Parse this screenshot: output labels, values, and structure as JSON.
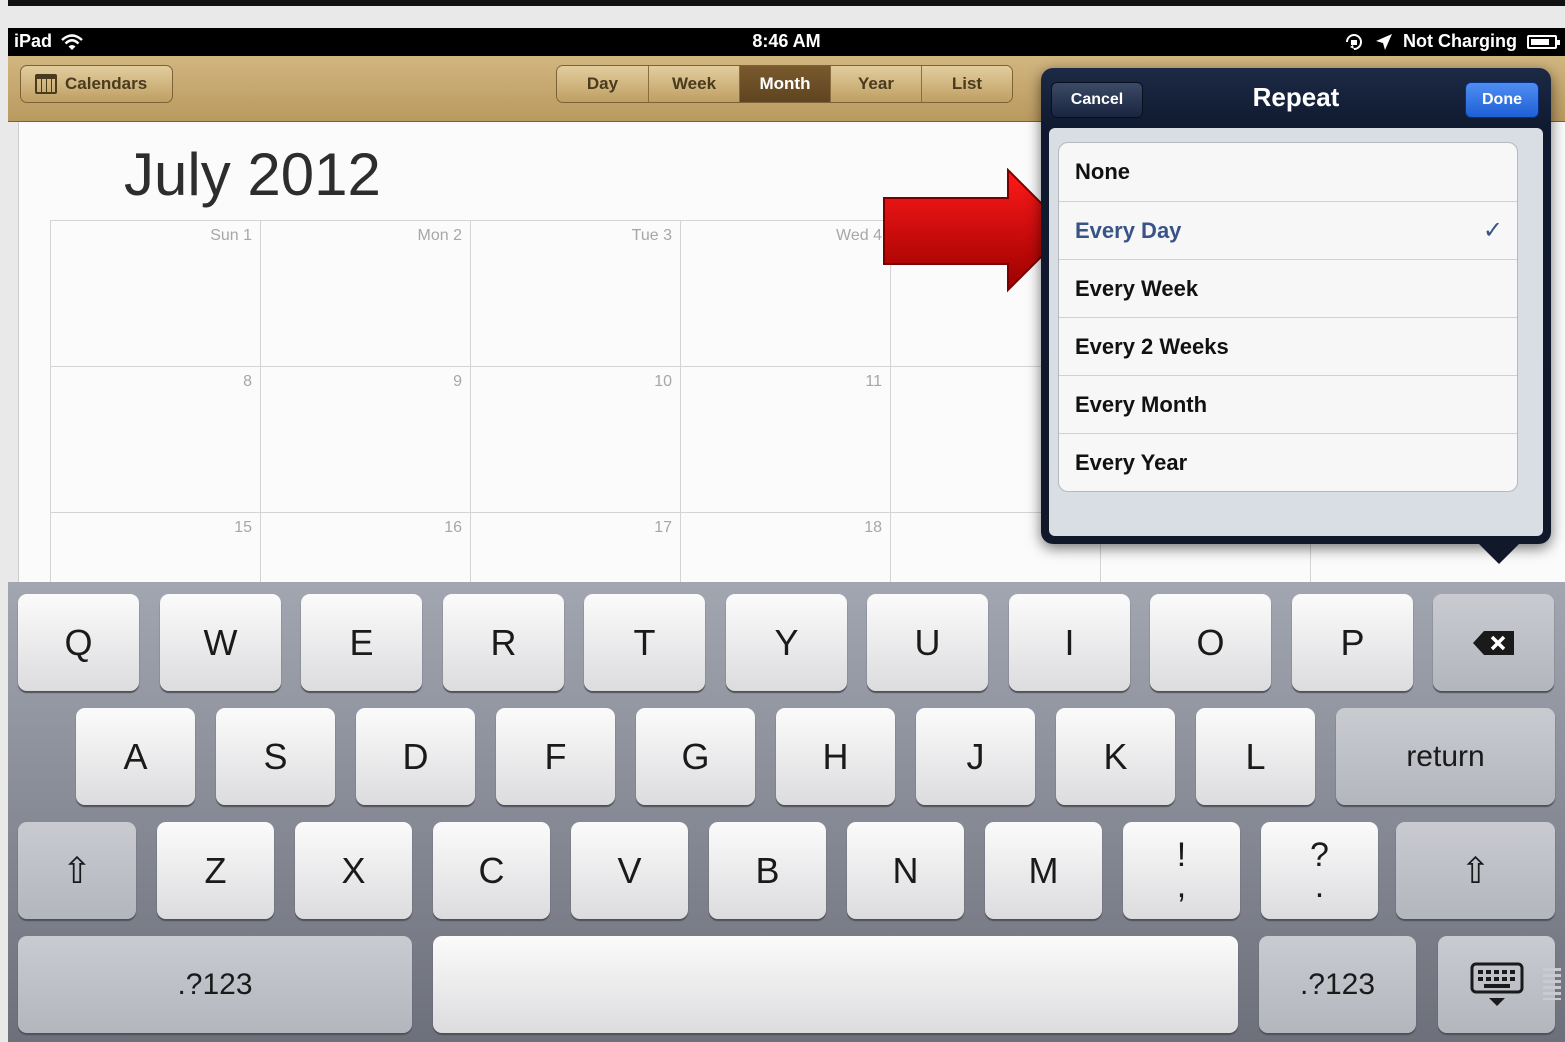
{
  "status_bar": {
    "device": "iPad",
    "time": "8:46 AM",
    "charging": "Not Charging"
  },
  "toolbar": {
    "calendars_label": "Calendars",
    "view_tabs": [
      "Day",
      "Week",
      "Month",
      "Year",
      "List"
    ],
    "active_view": "Month"
  },
  "calendar": {
    "month_title": "July 2012",
    "rows": [
      [
        "Sun 1",
        "Mon 2",
        "Tue 3",
        "Wed 4"
      ],
      [
        "8",
        "9",
        "10",
        "11"
      ],
      [
        "15",
        "16",
        "17",
        "18"
      ]
    ]
  },
  "popover": {
    "title": "Repeat",
    "cancel_label": "Cancel",
    "done_label": "Done",
    "options": [
      "None",
      "Every Day",
      "Every Week",
      "Every 2 Weeks",
      "Every Month",
      "Every Year"
    ],
    "selected": "Every Day",
    "check_glyph": "✓"
  },
  "keyboard": {
    "row1": [
      "Q",
      "W",
      "E",
      "R",
      "T",
      "Y",
      "U",
      "I",
      "O",
      "P"
    ],
    "row2": [
      "A",
      "S",
      "D",
      "F",
      "G",
      "H",
      "J",
      "K",
      "L"
    ],
    "row3": [
      "Z",
      "X",
      "C",
      "V",
      "B",
      "N",
      "M"
    ],
    "punct_1": [
      "!",
      ","
    ],
    "punct_2": [
      "?",
      "."
    ],
    "return_label": "return",
    "numbers_label": ".?123",
    "shift_glyph": "⇧",
    "icons": [
      "wifi-icon",
      "lock-rotation-icon",
      "location-icon",
      "battery-icon",
      "calendar-icon",
      "backspace-icon",
      "shift-icon",
      "keyboard-hide-icon",
      "checkmark-icon"
    ]
  },
  "colors": {
    "leather_top": "#d2b680",
    "active_segment": "#6a4e26",
    "popover_header": "#1d2a45",
    "done_button": "#2f73e4",
    "selected_option": "#385487",
    "annotation_arrow": "#d10000"
  }
}
